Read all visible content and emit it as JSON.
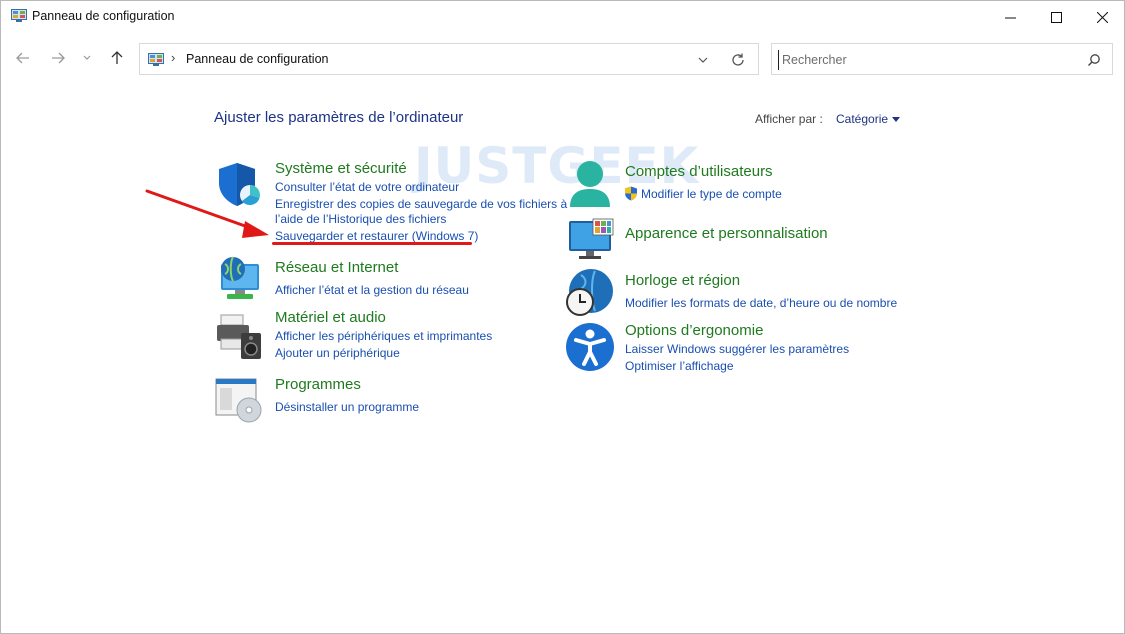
{
  "window": {
    "title": "Panneau de configuration"
  },
  "addressbar": {
    "path": "Panneau de configuration",
    "separator": "›"
  },
  "search": {
    "placeholder": "Rechercher"
  },
  "main": {
    "heading": "Ajuster les paramètres de l’ordinateur",
    "view_by_label": "Afficher par :",
    "view_by_value": "Catégorie"
  },
  "watermark": "JUSTGEEK",
  "categories": {
    "system": {
      "title": "Système et sécurité",
      "icon": "shield-icon",
      "links": [
        "Consulter l’état de votre ordinateur",
        "Enregistrer des copies de sauvegarde de vos fichiers à",
        "l’aide de l’Historique des fichiers",
        "Sauvegarder et restaurer (Windows 7)"
      ]
    },
    "network": {
      "title": "Réseau et Internet",
      "icon": "network-globe-icon",
      "links": [
        "Afficher l’état et la gestion du réseau"
      ]
    },
    "hardware": {
      "title": "Matériel et audio",
      "icon": "printer-speaker-icon",
      "links": [
        "Afficher les périphériques et imprimantes",
        "Ajouter un périphérique"
      ]
    },
    "programs": {
      "title": "Programmes",
      "icon": "programs-disc-icon",
      "links": [
        "Désinstaller un programme"
      ]
    },
    "users": {
      "title": "Comptes d’utilisateurs",
      "icon": "user-icon",
      "links": [
        "Modifier le type de compte"
      ]
    },
    "appearance": {
      "title": "Apparence et personnalisation",
      "icon": "monitor-icon",
      "links": []
    },
    "clock": {
      "title": "Horloge et région",
      "icon": "clock-globe-icon",
      "links": [
        "Modifier les formats de date, d’heure ou de nombre"
      ]
    },
    "ease": {
      "title": "Options d’ergonomie",
      "icon": "accessibility-icon",
      "links": [
        "Laisser Windows suggérer les paramètres",
        "Optimiser l’affichage"
      ]
    }
  },
  "colors": {
    "category_title": "#1f7a1f",
    "link": "#1a4fb0",
    "heading": "#1e3287",
    "annotation": "#e01818"
  }
}
